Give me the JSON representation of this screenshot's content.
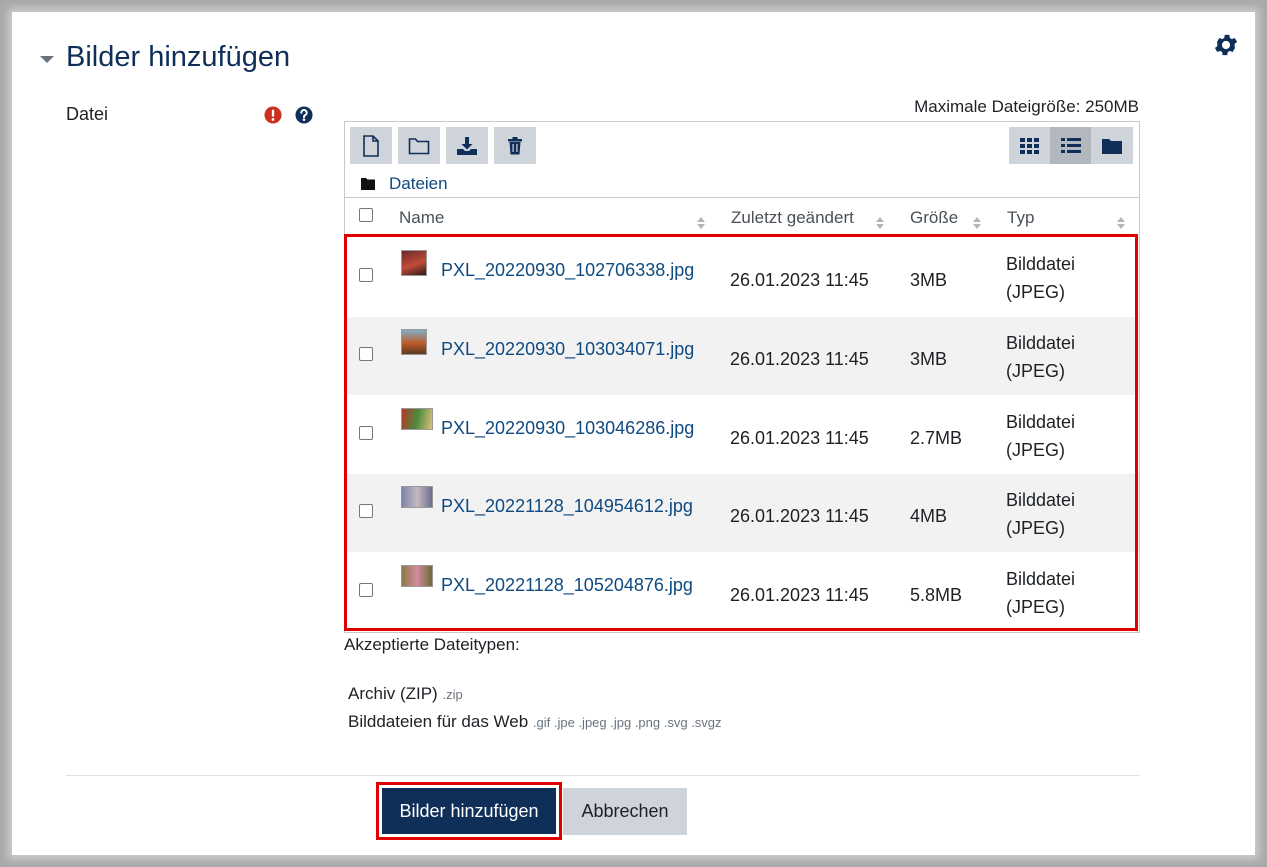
{
  "section": {
    "title": "Bilder hinzufügen"
  },
  "field": {
    "label": "Datei"
  },
  "filemanager": {
    "max_size": "Maximale Dateigröße: 250MB",
    "path_label": "Dateien",
    "columns": {
      "name": "Name",
      "modified": "Zuletzt geändert",
      "size": "Größe",
      "type": "Typ"
    },
    "files": [
      {
        "name": "PXL_20220930_102706338.jpg",
        "modified": "26.01.2023 11:45",
        "size": "3MB",
        "type": "Bilddatei (JPEG)"
      },
      {
        "name": "PXL_20220930_103034071.jpg",
        "modified": "26.01.2023 11:45",
        "size": "3MB",
        "type": "Bilddatei (JPEG)"
      },
      {
        "name": "PXL_20220930_103046286.jpg",
        "modified": "26.01.2023 11:45",
        "size": "2.7MB",
        "type": "Bilddatei (JPEG)"
      },
      {
        "name": "PXL_20221128_104954612.jpg",
        "modified": "26.01.2023 11:45",
        "size": "4MB",
        "type": "Bilddatei (JPEG)"
      },
      {
        "name": "PXL_20221128_105204876.jpg",
        "modified": "26.01.2023 11:45",
        "size": "5.8MB",
        "type": "Bilddatei (JPEG)"
      }
    ]
  },
  "accepted": {
    "label": "Akzeptierte Dateitypen:",
    "types": [
      {
        "name": "Archiv (ZIP)",
        "ext": ".zip"
      },
      {
        "name": "Bilddateien für das Web",
        "ext": ".gif .jpe .jpeg .jpg .png .svg .svgz"
      }
    ]
  },
  "buttons": {
    "submit": "Bilder hinzufügen",
    "cancel": "Abbrechen"
  },
  "colors": {
    "primary": "#0f2f59",
    "link": "#0f4a80",
    "highlight": "#e00000",
    "required": "#ca3120"
  },
  "icons": [
    "collapse-caret-icon",
    "gear-icon",
    "required-icon",
    "help-icon",
    "new-file-icon",
    "new-folder-icon",
    "download-icon",
    "trash-icon",
    "grid-view-icon",
    "list-view-icon",
    "tree-view-icon",
    "folder-icon",
    "sort-icon"
  ]
}
